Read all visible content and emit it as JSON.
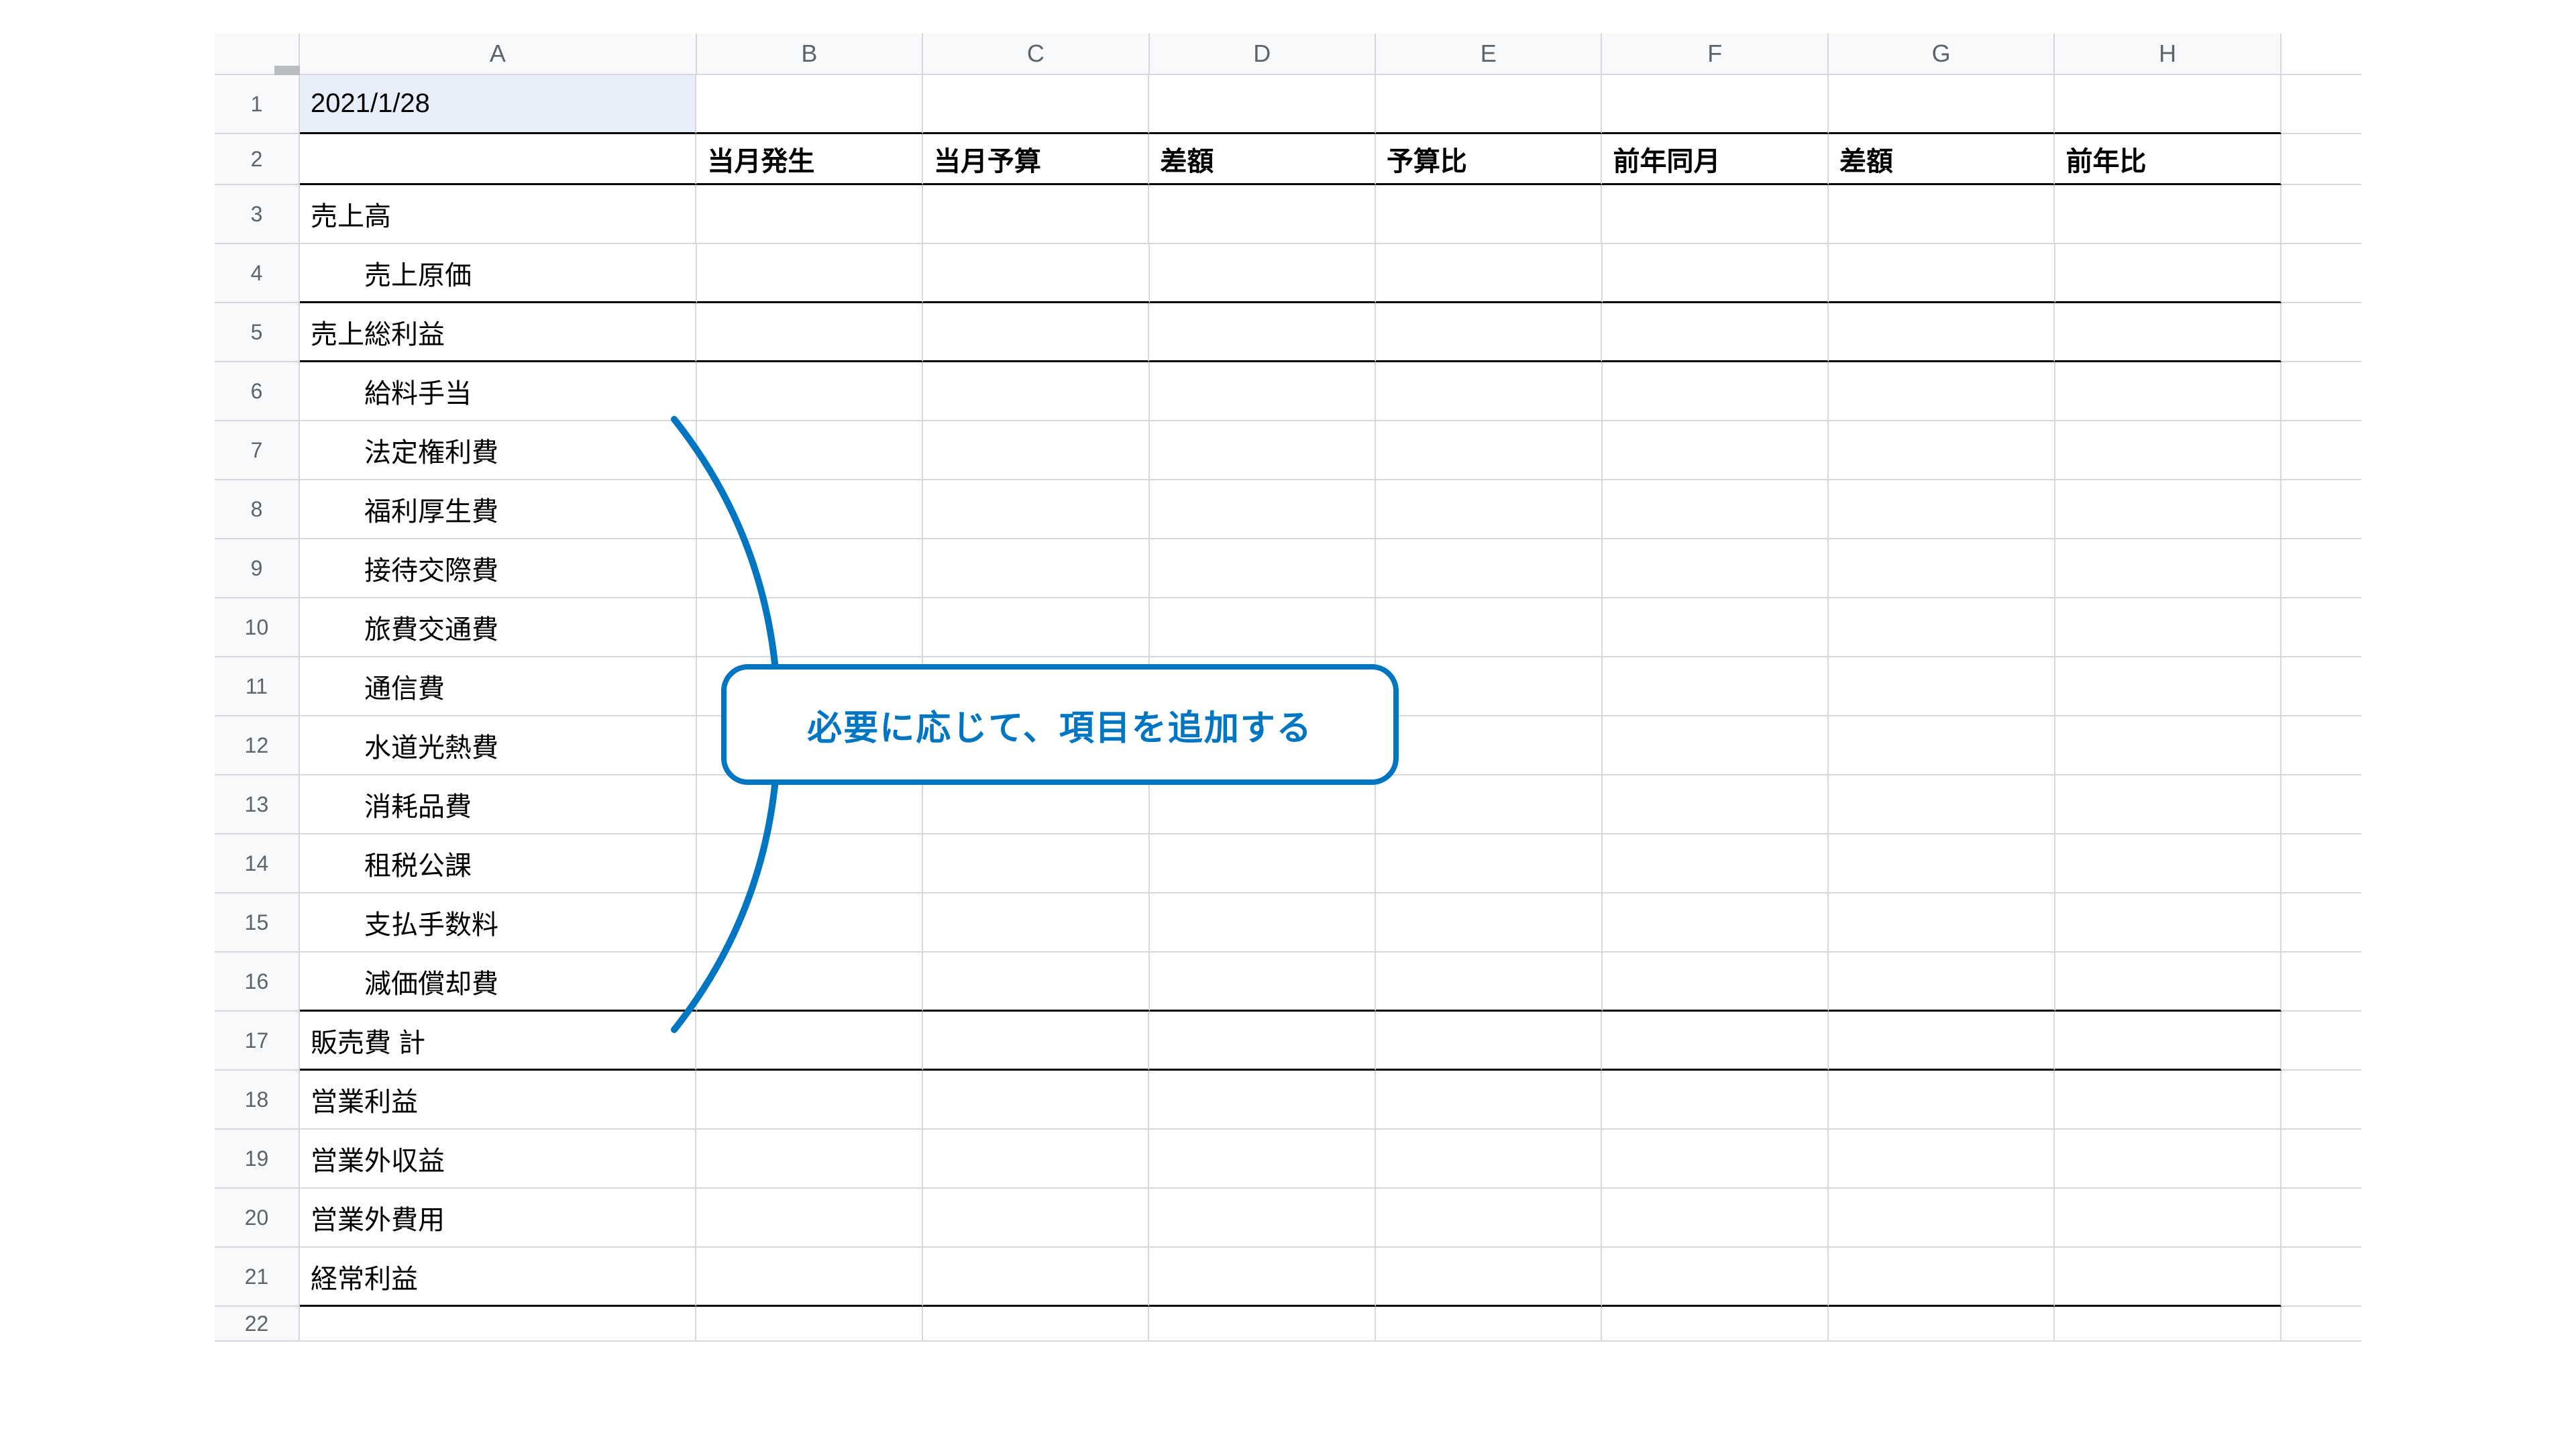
{
  "columns": [
    "A",
    "B",
    "C",
    "D",
    "E",
    "F",
    "G",
    "H"
  ],
  "rowNumbers": [
    "1",
    "2",
    "3",
    "4",
    "5",
    "6",
    "7",
    "8",
    "9",
    "10",
    "11",
    "12",
    "13",
    "14",
    "15",
    "16",
    "17",
    "18",
    "19",
    "20",
    "21",
    "22"
  ],
  "cells": {
    "A1": "2021/1/28",
    "hdr": {
      "B2": "当月発生",
      "C2": "当月予算",
      "D2": "差額",
      "E2": "予算比",
      "F2": "前年同月",
      "G2": "差額",
      "H2": "前年比"
    },
    "labels": {
      "A3": "売上高",
      "A4": "売上原価",
      "A5": "売上総利益",
      "A6": "給料手当",
      "A7": "法定権利費",
      "A8": "福利厚生費",
      "A9": "接待交際費",
      "A10": "旅費交通費",
      "A11": "通信費",
      "A12": "水道光熱費",
      "A13": "消耗品費",
      "A14": "租税公課",
      "A15": "支払手数料",
      "A16": "減価償却費",
      "A17": "販売費 計",
      "A18": "営業利益",
      "A19": "営業外収益",
      "A20": "営業外費用",
      "A21": "経常利益"
    }
  },
  "callout": "必要に応じて、項目を追加する",
  "annotation_color": "#0075c1",
  "indent": {
    "A4": 2,
    "A6": 2,
    "A7": 2,
    "A8": 2,
    "A9": 2,
    "A10": 2,
    "A11": 2,
    "A12": 2,
    "A13": 2,
    "A14": 2,
    "A15": 2,
    "A16": 2
  },
  "thickBottom": [
    "1",
    "2",
    "4",
    "5",
    "16",
    "17",
    "21"
  ]
}
